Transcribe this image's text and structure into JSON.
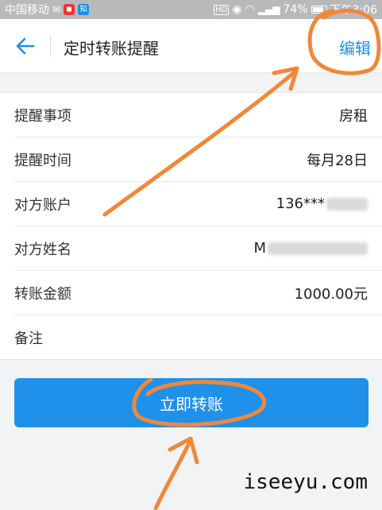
{
  "status_bar": {
    "carrier": "中国移动",
    "badge_text": "知",
    "battery": "74%",
    "time": "下午3:06"
  },
  "header": {
    "title": "定时转账提醒",
    "edit_label": "编辑"
  },
  "details": [
    {
      "label": "提醒事项",
      "value": "房租"
    },
    {
      "label": "提醒时间",
      "value": "每月28日"
    },
    {
      "label": "对方账户",
      "value": "136***"
    },
    {
      "label": "对方姓名",
      "value": "M"
    },
    {
      "label": "转账金额",
      "value": "1000.00元"
    },
    {
      "label": "备注",
      "value": ""
    }
  ],
  "actions": {
    "transfer_label": "立即转账"
  },
  "watermark": "iseeyu.com",
  "colors": {
    "accent": "#1f91ea",
    "annotation": "#f0883a"
  }
}
